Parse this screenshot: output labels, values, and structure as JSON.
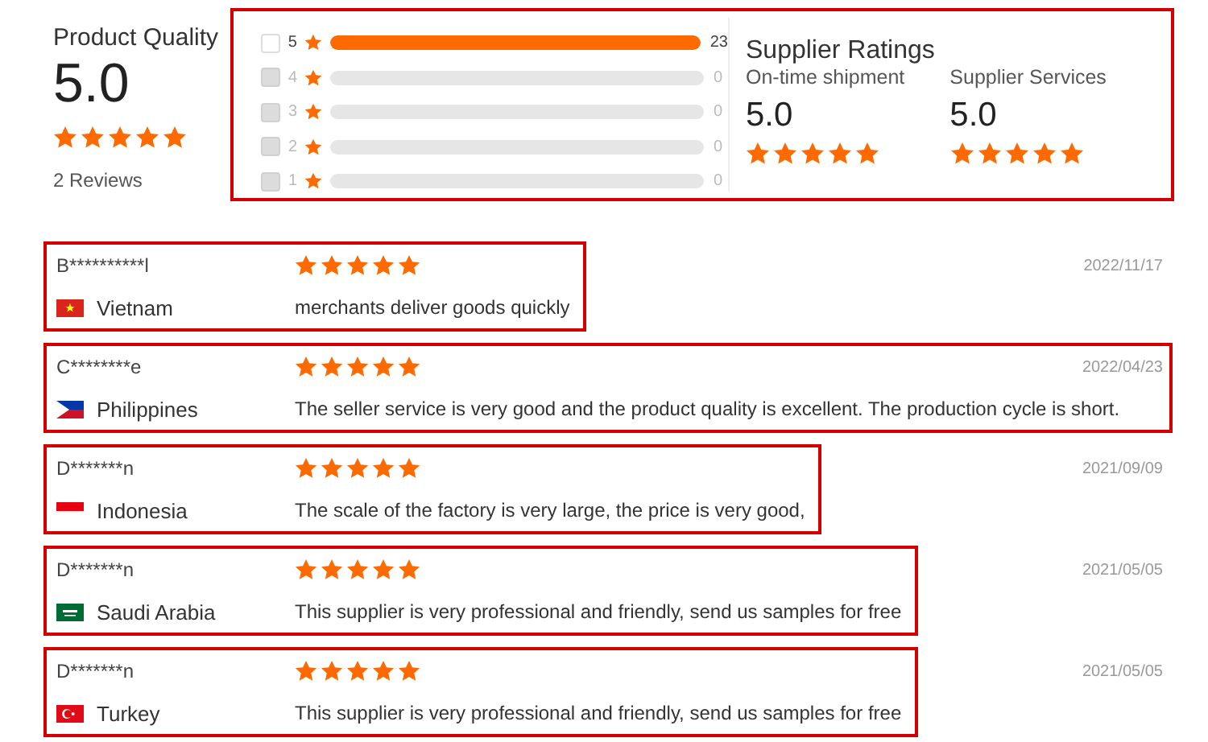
{
  "product_quality": {
    "title": "Product Quality",
    "score": "5.0",
    "stars": 5,
    "review_count": "2 Reviews"
  },
  "histogram": {
    "highlighted": true,
    "rows": [
      {
        "rating": "5",
        "level": 1,
        "count": "23",
        "disabled": false
      },
      {
        "rating": "4",
        "level": 0,
        "count": "0",
        "disabled": true
      },
      {
        "rating": "3",
        "level": 0,
        "count": "0",
        "disabled": true
      },
      {
        "rating": "2",
        "level": 0,
        "count": "0",
        "disabled": true
      },
      {
        "rating": "1",
        "level": 0,
        "count": "0",
        "disabled": true
      }
    ]
  },
  "supplier_ratings": {
    "title": "Supplier Ratings",
    "items": [
      {
        "label": "On-time shipment",
        "score": "5.0",
        "stars": 5
      },
      {
        "label": "Supplier Services",
        "score": "5.0",
        "stars": 5
      }
    ]
  },
  "reviews": [
    {
      "name": "B**********l",
      "country": "Vietnam",
      "stars": 5,
      "comment": "merchants deliver goods quickly",
      "date": "2022/11/17",
      "highlighted": true
    },
    {
      "name": "C********e",
      "country": "Philippines",
      "stars": 5,
      "comment": "The seller service is very good and the product quality is excellent. The production cycle is short.",
      "date": "2022/04/23",
      "highlighted": true
    },
    {
      "name": "D*******n",
      "country": "Indonesia",
      "stars": 5,
      "comment": "The scale of the factory is very large, the price is very good,",
      "date": "2021/09/09",
      "highlighted": true
    },
    {
      "name": "D*******n",
      "country": "Saudi Arabia",
      "stars": 5,
      "comment": "This supplier is very professional and friendly, send us samples for free",
      "date": "2021/05/05",
      "highlighted": true
    },
    {
      "name": "D*******n",
      "country": "Turkey",
      "stars": 5,
      "comment": "This supplier is very professional and friendly, send us samples for free",
      "date": "2021/05/05",
      "highlighted": true
    }
  ]
}
